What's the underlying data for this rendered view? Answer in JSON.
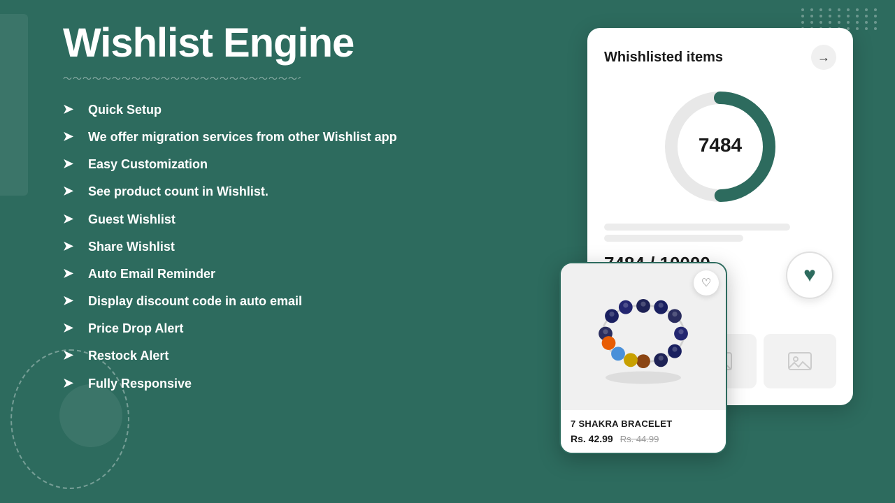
{
  "page": {
    "background_color": "#2d6b5e"
  },
  "header": {
    "title": "Wishlist Engine"
  },
  "features": {
    "items": [
      {
        "id": 1,
        "text": "Quick Setup"
      },
      {
        "id": 2,
        "text": "We offer migration services from other Wishlist app"
      },
      {
        "id": 3,
        "text": "Easy Customization"
      },
      {
        "id": 4,
        "text": "See product count in Wishlist."
      },
      {
        "id": 5,
        "text": "Guest Wishlist"
      },
      {
        "id": 6,
        "text": "Share Wishlist"
      },
      {
        "id": 7,
        "text": "Auto Email Reminder"
      },
      {
        "id": 8,
        "text": "Display discount code in auto email"
      },
      {
        "id": 9,
        "text": "Price Drop Alert"
      },
      {
        "id": 10,
        "text": "Restock Alert"
      },
      {
        "id": 11,
        "text": "Fully Responsive"
      }
    ],
    "arrow_symbol": "➤"
  },
  "wishlist_card": {
    "title": "Whishlisted items",
    "arrow": "→",
    "count": "7484",
    "count_ratio": "7484 / 10000",
    "donut": {
      "total": 10000,
      "filled": 7484,
      "color": "#2d6b5e",
      "bg_color": "#e8e8e8"
    }
  },
  "product_card": {
    "name": "7 SHAKRA BRACELET",
    "price_current": "Rs. 42.99",
    "price_original": "Rs. 44.99",
    "heart_icon": "♡",
    "heart_filled": "♥"
  },
  "icons": {
    "heart_outline": "♡",
    "heart_filled": "♥",
    "arrow_right": "→",
    "image_placeholder": "🖼"
  }
}
